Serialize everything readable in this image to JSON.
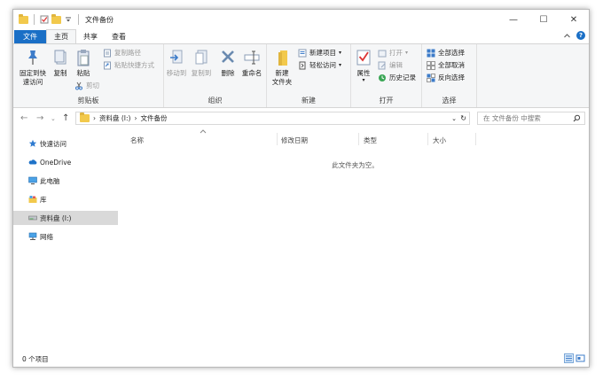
{
  "title": {
    "text": "文件备份"
  },
  "window_controls": {
    "minimize": "—",
    "maximize": "☐",
    "close": "✕"
  },
  "tabs": [
    {
      "label": "文件"
    },
    {
      "label": "主页"
    },
    {
      "label": "共享"
    },
    {
      "label": "查看"
    }
  ],
  "ribbon": {
    "clipboard": {
      "pin": "固定到快\n速访问",
      "copy": "复制",
      "paste": "粘贴",
      "copy_path": "复制路径",
      "paste_shortcut": "粘贴快捷方式",
      "cut": "剪切",
      "label": "剪贴板"
    },
    "organize": {
      "move_to": "移动到",
      "copy_to": "复制到",
      "delete": "删除",
      "rename": "重命名",
      "label": "组织"
    },
    "new": {
      "new_folder": "新建\n文件夹",
      "new_item": "新建项目",
      "easy_access": "轻松访问",
      "label": "新建"
    },
    "open": {
      "properties": "属性",
      "open": "打开",
      "edit": "编辑",
      "history": "历史记录",
      "label": "打开"
    },
    "select": {
      "select_all": "全部选择",
      "select_none": "全部取消",
      "invert": "反向选择",
      "label": "选择"
    }
  },
  "address": {
    "segments": [
      "资料盘 (I:)",
      "文件备份"
    ],
    "search_placeholder": "在 文件备份 中搜索"
  },
  "nav": [
    {
      "label": "快速访问"
    },
    {
      "label": "OneDrive"
    },
    {
      "label": "此电脑"
    },
    {
      "label": "库"
    },
    {
      "label": "资料盘 (I:)"
    },
    {
      "label": "网络"
    }
  ],
  "columns": [
    "名称",
    "修改日期",
    "类型",
    "大小"
  ],
  "empty_message": "此文件夹为空。",
  "status": {
    "count": "0 个项目"
  },
  "colors": {
    "accent": "#1a6fc6",
    "folder": "#f2c94c",
    "selected": "#d9d9d9"
  }
}
